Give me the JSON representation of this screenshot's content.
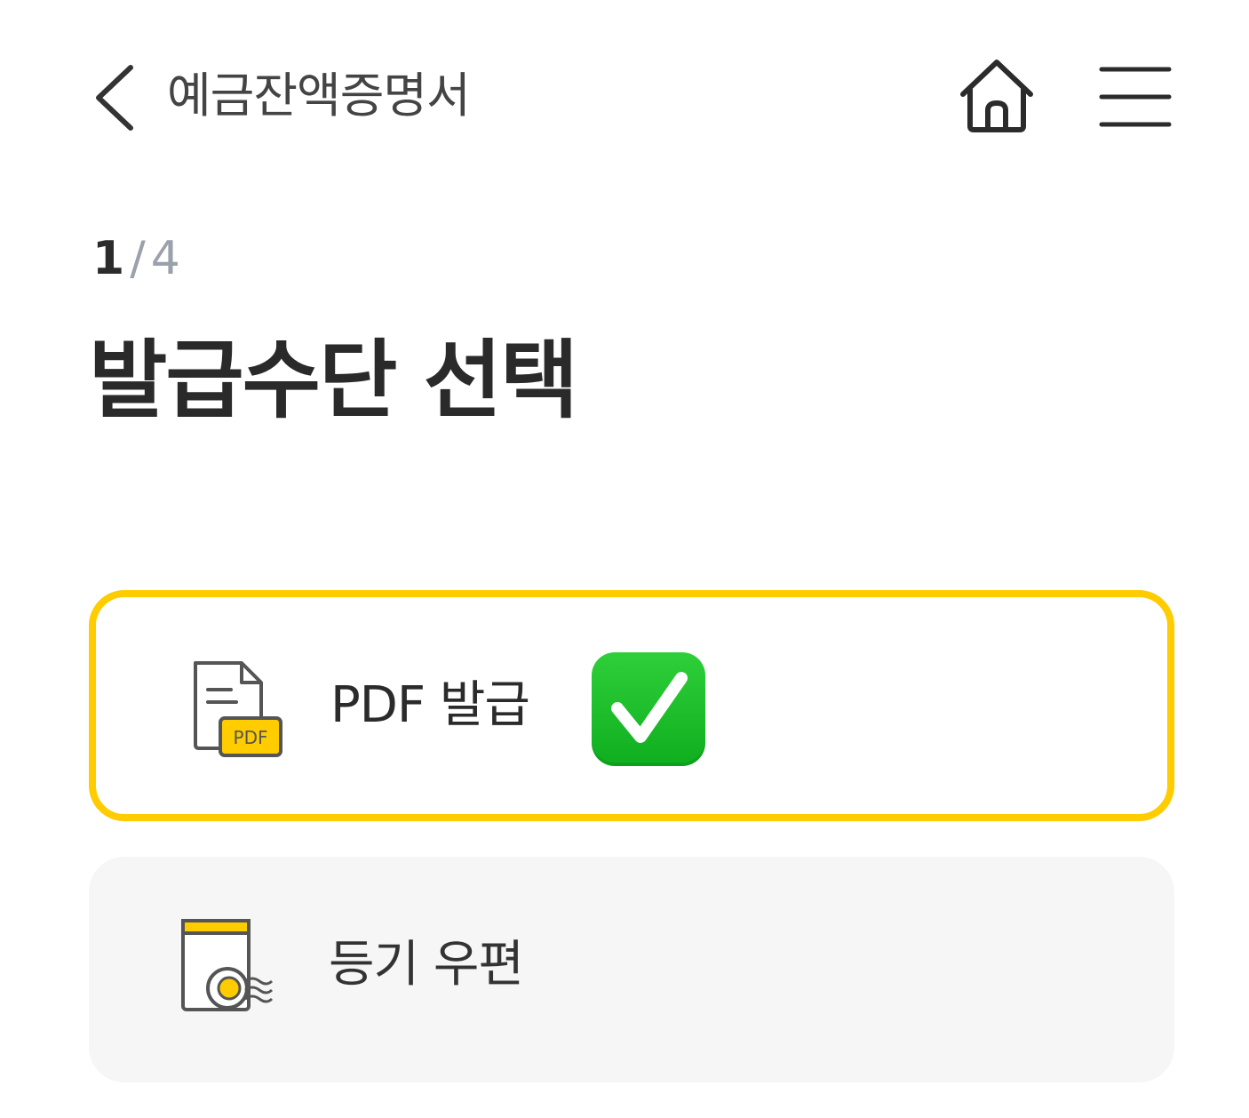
{
  "header": {
    "title": "예금잔액증명서",
    "back_icon": "chevron-left-icon",
    "home_icon": "home-icon",
    "menu_icon": "hamburger-menu-icon"
  },
  "step": {
    "current": "1",
    "separator": "/",
    "total": "4"
  },
  "page_title": "발급수단 선택",
  "options": [
    {
      "label": "PDF 발급",
      "icon": "pdf-document-icon",
      "icon_badge": "PDF",
      "selected": true,
      "selected_icon": "check-mark-button-icon"
    },
    {
      "label": "등기 우편",
      "icon": "registered-mail-icon",
      "selected": false
    }
  ],
  "colors": {
    "accent": "#ffcc00",
    "text": "#2b2b2b",
    "muted": "#9aa1ab",
    "unselected_bg": "#f6f6f6",
    "check_green": "#1db92c"
  }
}
